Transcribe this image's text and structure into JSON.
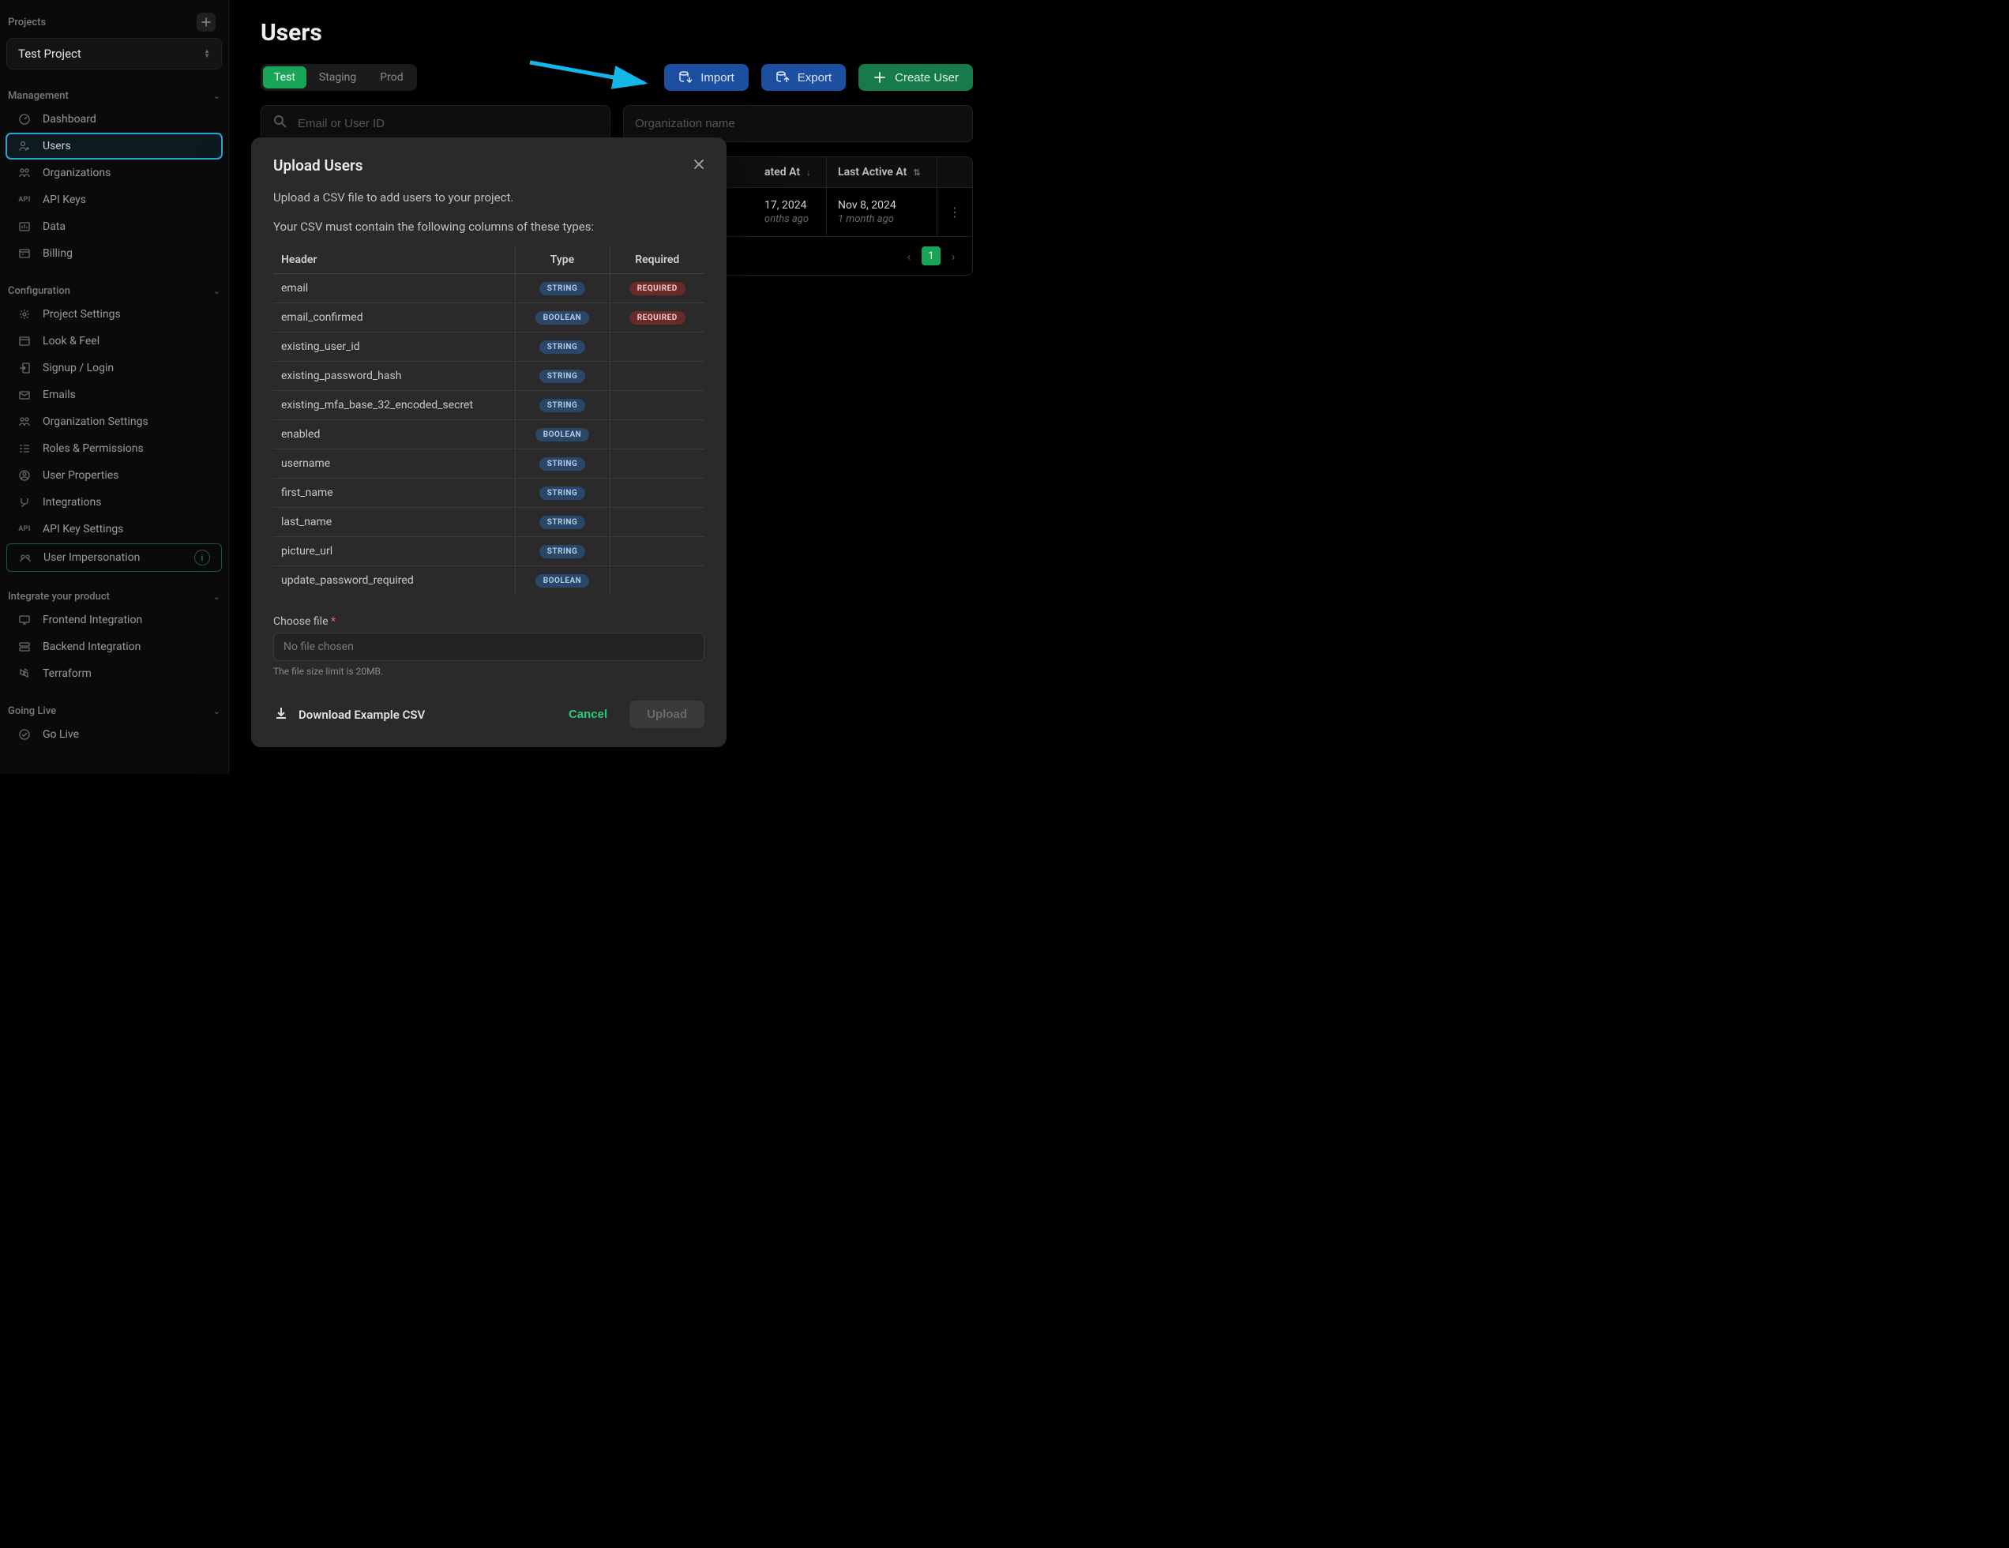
{
  "sidebar": {
    "projects_label": "Projects",
    "current_project": "Test Project",
    "sections": {
      "management": {
        "label": "Management",
        "items": [
          {
            "icon": "dashboard",
            "label": "Dashboard"
          },
          {
            "icon": "users",
            "label": "Users",
            "active": true
          },
          {
            "icon": "orgs",
            "label": "Organizations"
          },
          {
            "icon": "api",
            "label": "API Keys"
          },
          {
            "icon": "data",
            "label": "Data"
          },
          {
            "icon": "billing",
            "label": "Billing"
          }
        ]
      },
      "configuration": {
        "label": "Configuration",
        "items": [
          {
            "icon": "gear",
            "label": "Project Settings"
          },
          {
            "icon": "look",
            "label": "Look & Feel"
          },
          {
            "icon": "signup",
            "label": "Signup / Login"
          },
          {
            "icon": "mail",
            "label": "Emails"
          },
          {
            "icon": "orgsettings",
            "label": "Organization Settings"
          },
          {
            "icon": "roles",
            "label": "Roles & Permissions"
          },
          {
            "icon": "userprops",
            "label": "User Properties"
          },
          {
            "icon": "integrations",
            "label": "Integrations"
          },
          {
            "icon": "api",
            "label": "API Key Settings"
          },
          {
            "icon": "impersonation",
            "label": "User Impersonation",
            "highlight": true
          }
        ]
      },
      "integrate": {
        "label": "Integrate your product",
        "items": [
          {
            "icon": "frontend",
            "label": "Frontend Integration"
          },
          {
            "icon": "backend",
            "label": "Backend Integration"
          },
          {
            "icon": "terraform",
            "label": "Terraform"
          }
        ]
      },
      "golive": {
        "label": "Going Live",
        "items": [
          {
            "icon": "golive",
            "label": "Go Live"
          }
        ]
      }
    }
  },
  "page": {
    "title": "Users",
    "env_tabs": [
      "Test",
      "Staging",
      "Prod"
    ],
    "active_env": "Test",
    "buttons": {
      "import": "Import",
      "export": "Export",
      "create": "Create User"
    },
    "search1_placeholder": "Email or User ID",
    "search2_placeholder": "Organization name",
    "table": {
      "col_created": "ated At",
      "col_lastactive": "Last Active At",
      "row1": {
        "created_date": "17, 2024",
        "created_rel": "onths ago",
        "lastactive_date": "Nov 8, 2024",
        "lastactive_rel": "1 month ago"
      }
    },
    "page_num": "1"
  },
  "modal": {
    "title": "Upload Users",
    "text1": "Upload a CSV file to add users to your project.",
    "text2": "Your CSV must contain the following columns of these types:",
    "headers": {
      "header": "Header",
      "type": "Type",
      "required": "Required"
    },
    "rows": [
      {
        "header": "email",
        "type": "STRING",
        "required": "REQUIRED"
      },
      {
        "header": "email_confirmed",
        "type": "BOOLEAN",
        "required": "REQUIRED"
      },
      {
        "header": "existing_user_id",
        "type": "STRING",
        "required": ""
      },
      {
        "header": "existing_password_hash",
        "type": "STRING",
        "required": ""
      },
      {
        "header": "existing_mfa_base_32_encoded_secret",
        "type": "STRING",
        "required": ""
      },
      {
        "header": "enabled",
        "type": "BOOLEAN",
        "required": ""
      },
      {
        "header": "username",
        "type": "STRING",
        "required": ""
      },
      {
        "header": "first_name",
        "type": "STRING",
        "required": ""
      },
      {
        "header": "last_name",
        "type": "STRING",
        "required": ""
      },
      {
        "header": "picture_url",
        "type": "STRING",
        "required": ""
      },
      {
        "header": "update_password_required",
        "type": "BOOLEAN",
        "required": ""
      }
    ],
    "choose_file_label": "Choose file",
    "file_placeholder": "No file chosen",
    "file_hint": "The file size limit is 20MB.",
    "download_link": "Download Example CSV",
    "cancel": "Cancel",
    "upload": "Upload"
  }
}
